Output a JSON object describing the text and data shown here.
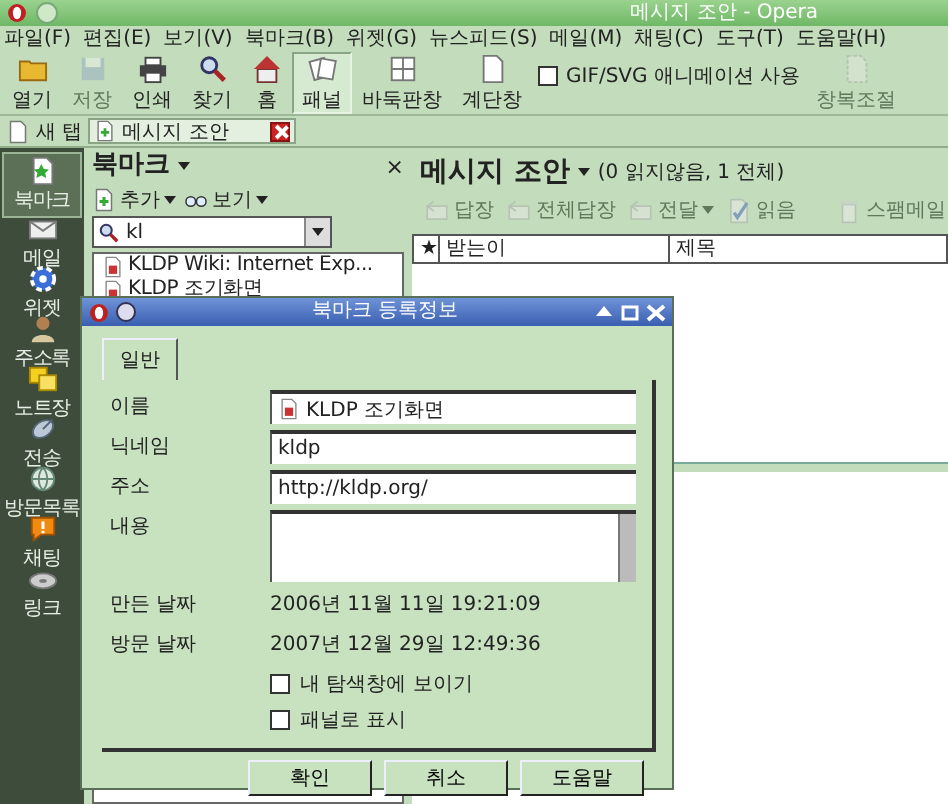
{
  "window": {
    "title": "메시지 조안 - Opera"
  },
  "menu": [
    "파일(F)",
    "편집(E)",
    "보기(V)",
    "북마크(B)",
    "위젯(G)",
    "뉴스피드(S)",
    "메일(M)",
    "채팅(C)",
    "도구(T)",
    "도움말(H)"
  ],
  "toolbar": [
    {
      "kind": "button",
      "label": "열기",
      "disabled": false,
      "pressed": false
    },
    {
      "kind": "button",
      "label": "저장",
      "disabled": true,
      "pressed": false
    },
    {
      "kind": "button",
      "label": "인쇄",
      "disabled": false,
      "pressed": false
    },
    {
      "kind": "button",
      "label": "찾기",
      "disabled": false,
      "pressed": false
    },
    {
      "kind": "button",
      "label": "홈",
      "disabled": false,
      "pressed": false
    },
    {
      "kind": "button",
      "label": "패널",
      "disabled": false,
      "pressed": true
    },
    {
      "kind": "button",
      "label": "바둑판창",
      "disabled": false,
      "pressed": false
    },
    {
      "kind": "button",
      "label": "계단창",
      "disabled": false,
      "pressed": false
    },
    {
      "kind": "checkbox",
      "label": "GIF/SVG 애니메이션 사용",
      "checked": false
    },
    {
      "kind": "button",
      "label": "창복조절",
      "disabled": true,
      "pressed": false
    }
  ],
  "tab_bar": {
    "new_tab": "새 탭",
    "tabs": [
      {
        "label": "메시지 조안",
        "selected": true
      }
    ]
  },
  "panel_selector": [
    {
      "label": "북마크",
      "selected": true
    },
    {
      "label": "메일",
      "selected": false
    },
    {
      "label": "위젯",
      "selected": false
    },
    {
      "label": "주소록",
      "selected": false
    },
    {
      "label": "노트장",
      "selected": false
    },
    {
      "label": "전송",
      "selected": false
    },
    {
      "label": "방문목록",
      "selected": false
    },
    {
      "label": "채팅",
      "selected": false
    },
    {
      "label": "링크",
      "selected": false
    }
  ],
  "bookmarks": {
    "title": "북마크",
    "close": "×",
    "tools": [
      {
        "label": "추가"
      },
      {
        "label": "보기"
      }
    ],
    "search": {
      "value": "kl"
    },
    "items": [
      {
        "label": "KLDP Wiki: Internet Exp..."
      },
      {
        "label": "KLDP 조기화면"
      }
    ]
  },
  "mail": {
    "title": "메시지 조안",
    "summary": "(0 읽지않음, 1 전체)",
    "tools": [
      {
        "label": "답장",
        "disabled": true,
        "dropdown": false
      },
      {
        "label": "전체답장",
        "disabled": true,
        "dropdown": false
      },
      {
        "label": "전달",
        "disabled": true,
        "dropdown": true
      },
      {
        "label": "읽음",
        "disabled": true,
        "dropdown": false
      },
      {
        "label": "스팸메일",
        "disabled": true,
        "dropdown": false
      }
    ],
    "columns": [
      "★",
      "받는이",
      "제목"
    ]
  },
  "dialog": {
    "title": "북마크 등록정보",
    "tabs": [
      {
        "label": "일반",
        "selected": true
      }
    ],
    "fields": [
      {
        "kind": "icon-text",
        "label": "이름",
        "value": "KLDP 조기화면"
      },
      {
        "kind": "text",
        "label": "닉네임",
        "value": "kldp"
      },
      {
        "kind": "text",
        "label": "주소",
        "value": "http://kldp.org/"
      },
      {
        "kind": "textarea",
        "label": "내용"
      }
    ],
    "info": [
      {
        "label": "만든 날짜",
        "value": "2006년 11월 11일 19:21:09"
      },
      {
        "label": "방문 날짜",
        "value": "2007년 12월 29일 12:49:36"
      }
    ],
    "checkboxes": [
      {
        "label": "내 탐색창에 보이기",
        "checked": false
      },
      {
        "label": "패널로 표시",
        "checked": false
      }
    ],
    "buttons": [
      "확인",
      "취소",
      "도움말"
    ]
  }
}
